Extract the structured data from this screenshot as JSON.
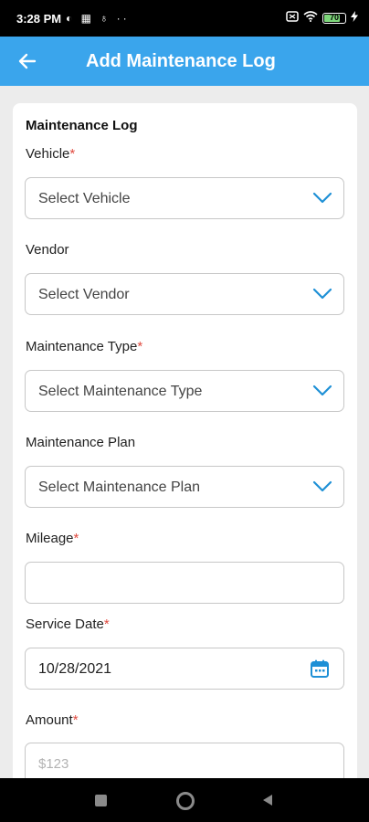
{
  "status_bar": {
    "time": "3:28 PM",
    "battery_level": "70",
    "left_icons": "◐ ▦ ♁ ··"
  },
  "app_bar": {
    "title": "Add Maintenance Log",
    "back_icon": "arrow-left-icon"
  },
  "form": {
    "section_title": "Maintenance Log",
    "required_marker": "*",
    "fields": {
      "vehicle": {
        "label": "Vehicle",
        "value": "Select Vehicle",
        "required": true
      },
      "vendor": {
        "label": "Vendor",
        "value": "Select Vendor",
        "required": false
      },
      "maintenance_type": {
        "label": "Maintenance Type",
        "value": "Select Maintenance Type",
        "required": true
      },
      "maintenance_plan": {
        "label": "Maintenance Plan",
        "value": "Select Maintenance Plan",
        "required": false
      },
      "mileage": {
        "label": "Mileage",
        "value": "",
        "required": true
      },
      "service_date": {
        "label": "Service Date",
        "value": "10/28/2021",
        "required": true
      },
      "amount": {
        "label": "Amount",
        "placeholder": "$123",
        "required": true
      }
    }
  },
  "colors": {
    "accent": "#3aa5ec",
    "required": "#e04a3f",
    "icon_blue": "#1e90d6"
  }
}
